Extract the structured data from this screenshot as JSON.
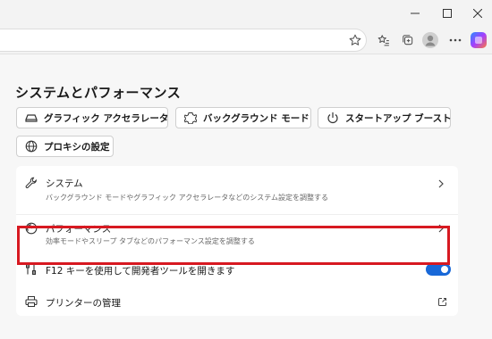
{
  "settings": {
    "title": "システムとパフォーマンス",
    "chips": [
      {
        "label": "グラフィック アクセラレータ",
        "icon": "graphics-card-icon"
      },
      {
        "label": "バックグラウンド モード",
        "icon": "background-mode-icon"
      },
      {
        "label": "スタートアップ ブースト",
        "icon": "power-icon"
      },
      {
        "label": "プロキシの設定",
        "icon": "globe-icon"
      }
    ],
    "rows": [
      {
        "title": "システム",
        "subtitle": "バックグラウンド モードやグラフィック アクセラレータなどのシステム設定を調整する",
        "icon": "wrench-icon"
      },
      {
        "title": "パフォーマンス",
        "subtitle": "効率モードやスリープ タブなどのパフォーマンス設定を調整する",
        "icon": "performance-gauge-icon"
      },
      {
        "title": "F12 キーを使用して開発者ツールを開きます",
        "icon": "developer-tools-icon",
        "toggle_on": true
      },
      {
        "title": "プリンターの管理",
        "icon": "printer-icon"
      }
    ]
  },
  "colors": {
    "accent": "#1868d8",
    "highlight": "#d71921"
  }
}
